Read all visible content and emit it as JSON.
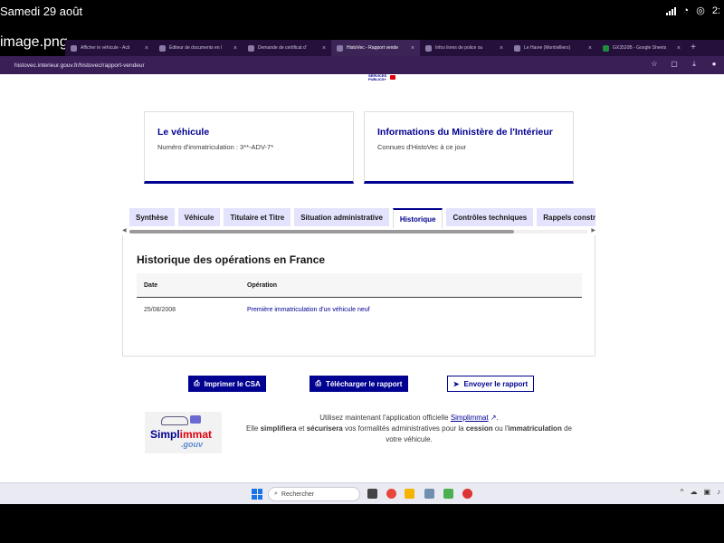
{
  "ipad": {
    "time": "Samedi 29 août",
    "right_clock": "2:",
    "file_title": "image.png"
  },
  "browser": {
    "tabs": [
      {
        "label": "Afficher le véhicule - Acti",
        "active": false
      },
      {
        "label": "Éditeur de documents en l",
        "active": false
      },
      {
        "label": "Demande de certificat d'",
        "active": false
      },
      {
        "label": "HistoVec - Rapport vende",
        "active": true
      },
      {
        "label": "Infos livres de police ou",
        "active": false
      },
      {
        "label": "Le Havre (Montivilliers)",
        "active": false
      },
      {
        "label": "GX3520B - Google Sheets",
        "active": false
      }
    ],
    "new_tab": "+",
    "url": "histovec.interieur.gouv.fr/histovec/rapport-vendeur"
  },
  "page": {
    "logo_lines": [
      "SERVICES",
      "PUBLICS+"
    ],
    "card_vehicle": {
      "title": "Le véhicule",
      "text": "Numéro d'immatriculation : 3**-ADV-7*"
    },
    "card_ministry": {
      "title": "Informations du Ministère de l'Intérieur",
      "text": "Connues d'HistoVec à ce jour"
    },
    "tabs": [
      {
        "label": "Synthèse",
        "active": false
      },
      {
        "label": "Véhicule",
        "active": false
      },
      {
        "label": "Titulaire et Titre",
        "active": false
      },
      {
        "label": "Situation administrative",
        "active": false
      },
      {
        "label": "Historique",
        "active": true
      },
      {
        "label": "Contrôles techniques",
        "active": false
      },
      {
        "label": "Rappels constructeur",
        "active": false
      }
    ],
    "history": {
      "heading": "Historique des opérations en France",
      "col_date": "Date",
      "col_operation": "Opération",
      "rows": [
        {
          "date": "25/08/2008",
          "operation": "Première immatriculation d'un véhicule neuf"
        }
      ]
    },
    "buttons": {
      "print": "Imprimer le CSA",
      "download": "Télécharger le rapport",
      "send": "Envoyer le rapport"
    },
    "simplimmat": {
      "logo_main": "Simpl",
      "logo_accent": "immat",
      "logo_suffix": ".gouv",
      "line1_pre": "Utilisez maintenant l'application officielle ",
      "line1_link": "Simplimmat",
      "line2_a": "Elle ",
      "line2_b": "simplifiera",
      "line2_c": " et ",
      "line2_d": "sécurisera",
      "line2_e": " vos formalités administratives pour la ",
      "line2_f": "cession",
      "line2_g": " ou l'",
      "line2_h": "immatriculation",
      "line2_i": " de",
      "line3": "votre véhicule."
    }
  },
  "taskbar": {
    "search_placeholder": "Rechercher"
  },
  "colors": {
    "accent": "#000091",
    "marianne_red": "#e1000f",
    "tab_bg": "#e3e3fd"
  }
}
